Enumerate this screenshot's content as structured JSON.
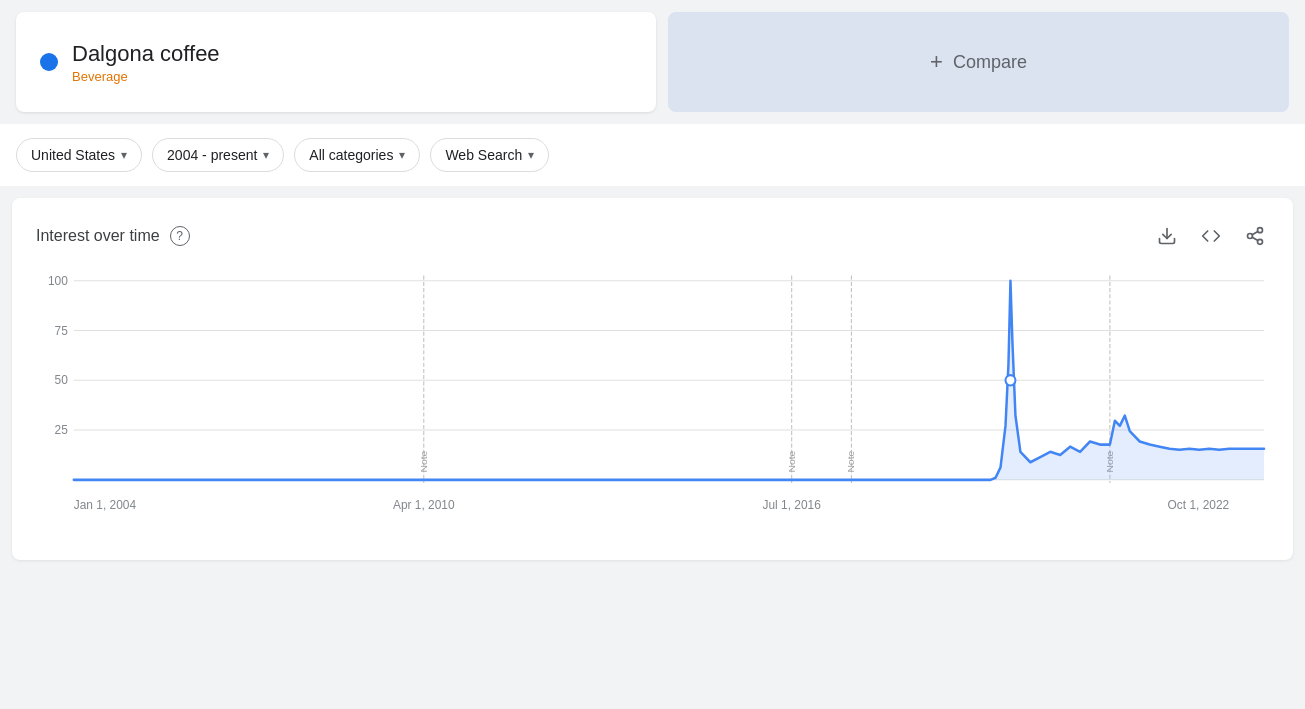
{
  "term": {
    "name": "Dalgona coffee",
    "category": "Beverage",
    "dot_color": "#1a73e8"
  },
  "compare": {
    "label": "Compare",
    "plus": "+"
  },
  "filters": [
    {
      "id": "location",
      "label": "United States",
      "has_arrow": true
    },
    {
      "id": "time",
      "label": "2004 - present",
      "has_arrow": true
    },
    {
      "id": "category",
      "label": "All categories",
      "has_arrow": true
    },
    {
      "id": "search_type",
      "label": "Web Search",
      "has_arrow": true
    }
  ],
  "chart": {
    "title": "Interest over time",
    "y_labels": [
      "100",
      "75",
      "50",
      "25",
      ""
    ],
    "x_labels": [
      "Jan 1, 2004",
      "Apr 1, 2010",
      "Jul 1, 2016",
      "Oct 1, 2022"
    ],
    "note_labels": [
      "Note",
      "Note",
      "Note",
      "Note"
    ],
    "actions": {
      "download": "↓",
      "embed": "<>",
      "share": "⋮"
    }
  }
}
